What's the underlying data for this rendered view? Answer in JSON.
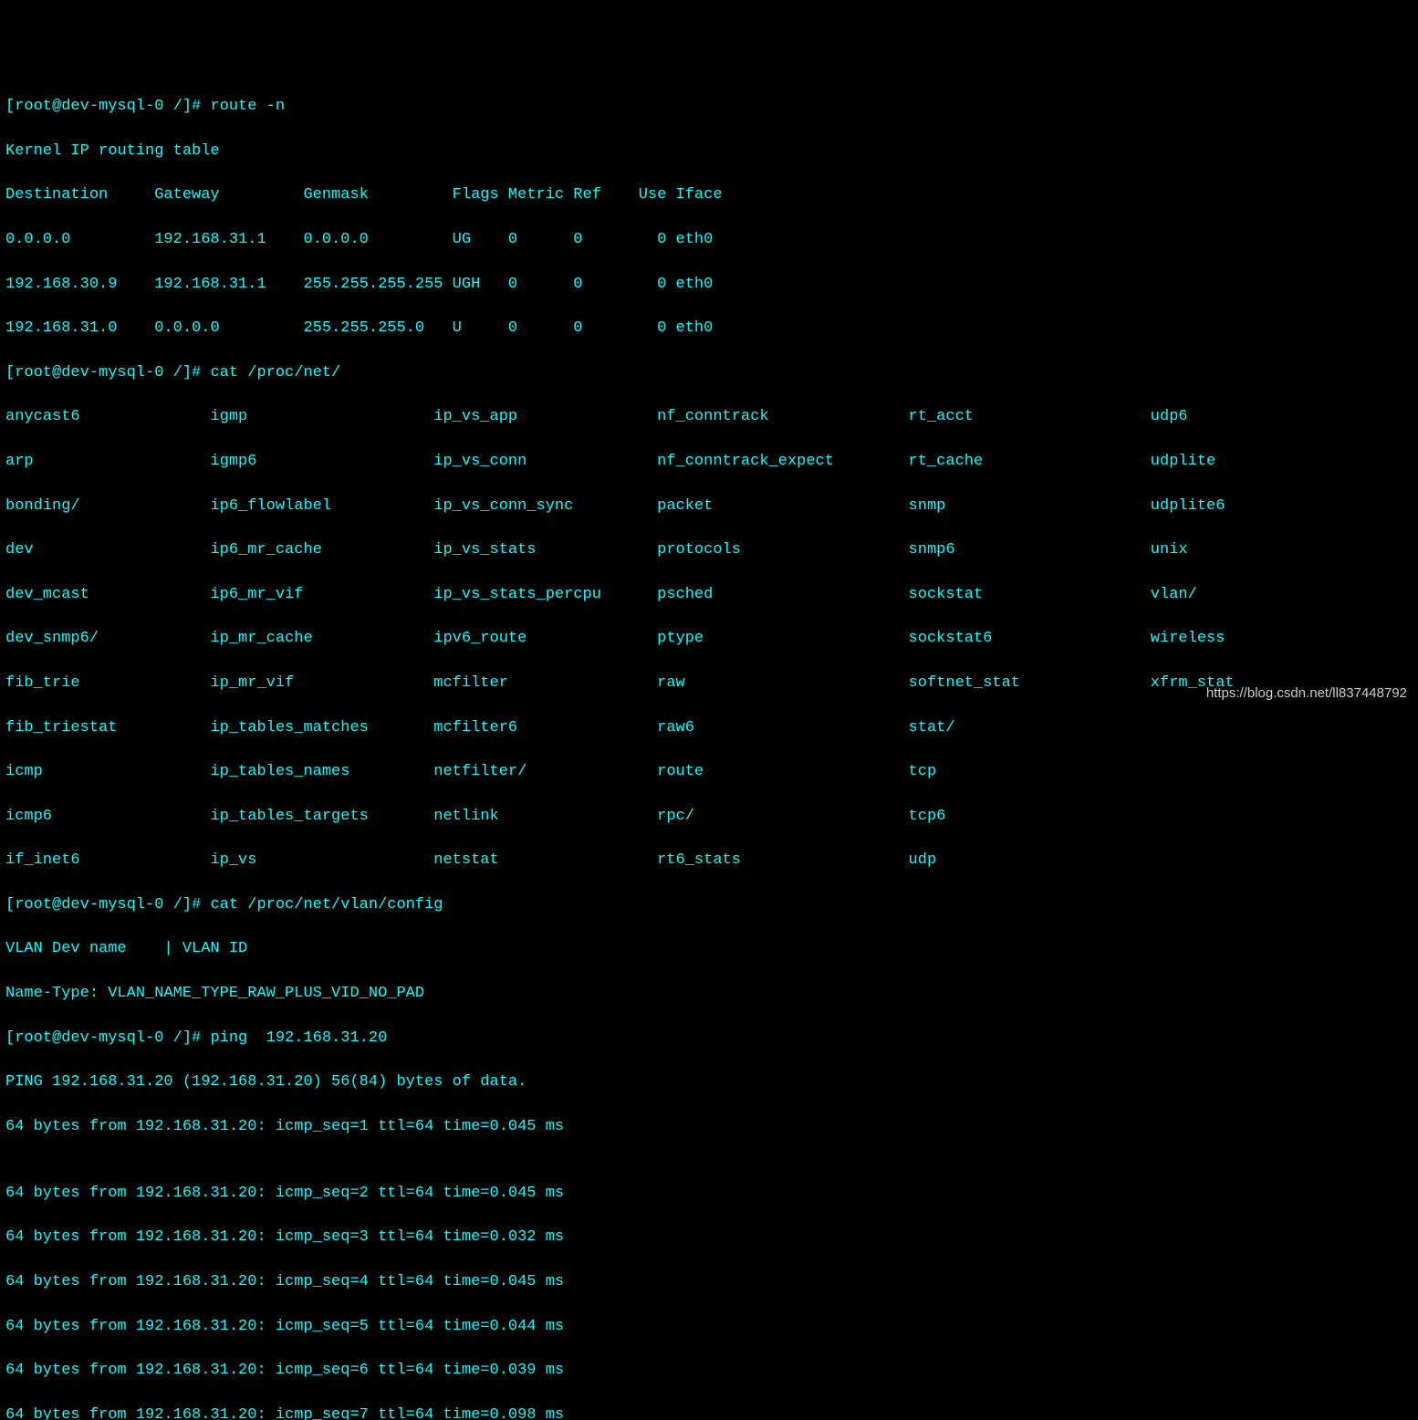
{
  "prompt1": "[root@dev-mysql-0 /]# ",
  "cmd1": "route -n",
  "route_header": "Kernel IP routing table",
  "route_cols": "Destination     Gateway         Genmask         Flags Metric Ref    Use Iface",
  "route_rows": [
    "0.0.0.0         192.168.31.1    0.0.0.0         UG    0      0        0 eth0",
    "192.168.30.9    192.168.31.1    255.255.255.255 UGH   0      0        0 eth0",
    "192.168.31.0    0.0.0.0         255.255.255.0   U     0      0        0 eth0"
  ],
  "prompt2": "[root@dev-mysql-0 /]# ",
  "cmd2": "cat /proc/net/",
  "ls_rows": [
    "anycast6              igmp                    ip_vs_app               nf_conntrack               rt_acct                   udp6",
    "arp                   igmp6                   ip_vs_conn              nf_conntrack_expect        rt_cache                  udplite",
    "bonding/              ip6_flowlabel           ip_vs_conn_sync         packet                     snmp                      udplite6",
    "dev                   ip6_mr_cache            ip_vs_stats             protocols                  snmp6                     unix",
    "dev_mcast             ip6_mr_vif              ip_vs_stats_percpu      psched                     sockstat                  vlan/",
    "dev_snmp6/            ip_mr_cache             ipv6_route              ptype                      sockstat6                 wireless",
    "fib_trie              ip_mr_vif               mcfilter                raw                        softnet_stat              xfrm_stat",
    "fib_triestat          ip_tables_matches       mcfilter6               raw6                       stat/",
    "icmp                  ip_tables_names         netfilter/              route                      tcp",
    "icmp6                 ip_tables_targets       netlink                 rpc/                       tcp6",
    "if_inet6              ip_vs                   netstat                 rt6_stats                  udp"
  ],
  "prompt3": "[root@dev-mysql-0 /]# ",
  "cmd3": "cat /proc/net/vlan/config",
  "vlan_out": [
    "VLAN Dev name    | VLAN ID",
    "Name-Type: VLAN_NAME_TYPE_RAW_PLUS_VID_NO_PAD"
  ],
  "prompt4": "[root@dev-mysql-0 /]# ",
  "cmd4": "ping  192.168.31.20",
  "ping_header": "PING 192.168.31.20 (192.168.31.20) 56(84) bytes of data.",
  "ping_rows": [
    "64 bytes from 192.168.31.20: icmp_seq=1 ttl=64 time=0.045 ms",
    "",
    "64 bytes from 192.168.31.20: icmp_seq=2 ttl=64 time=0.045 ms",
    "64 bytes from 192.168.31.20: icmp_seq=3 ttl=64 time=0.032 ms",
    "64 bytes from 192.168.31.20: icmp_seq=4 ttl=64 time=0.045 ms",
    "64 bytes from 192.168.31.20: icmp_seq=5 ttl=64 time=0.044 ms",
    "64 bytes from 192.168.31.20: icmp_seq=6 ttl=64 time=0.039 ms",
    "64 bytes from 192.168.31.20: icmp_seq=7 ttl=64 time=0.098 ms"
  ],
  "watermark": "https://blog.csdn.net/ll837448792"
}
